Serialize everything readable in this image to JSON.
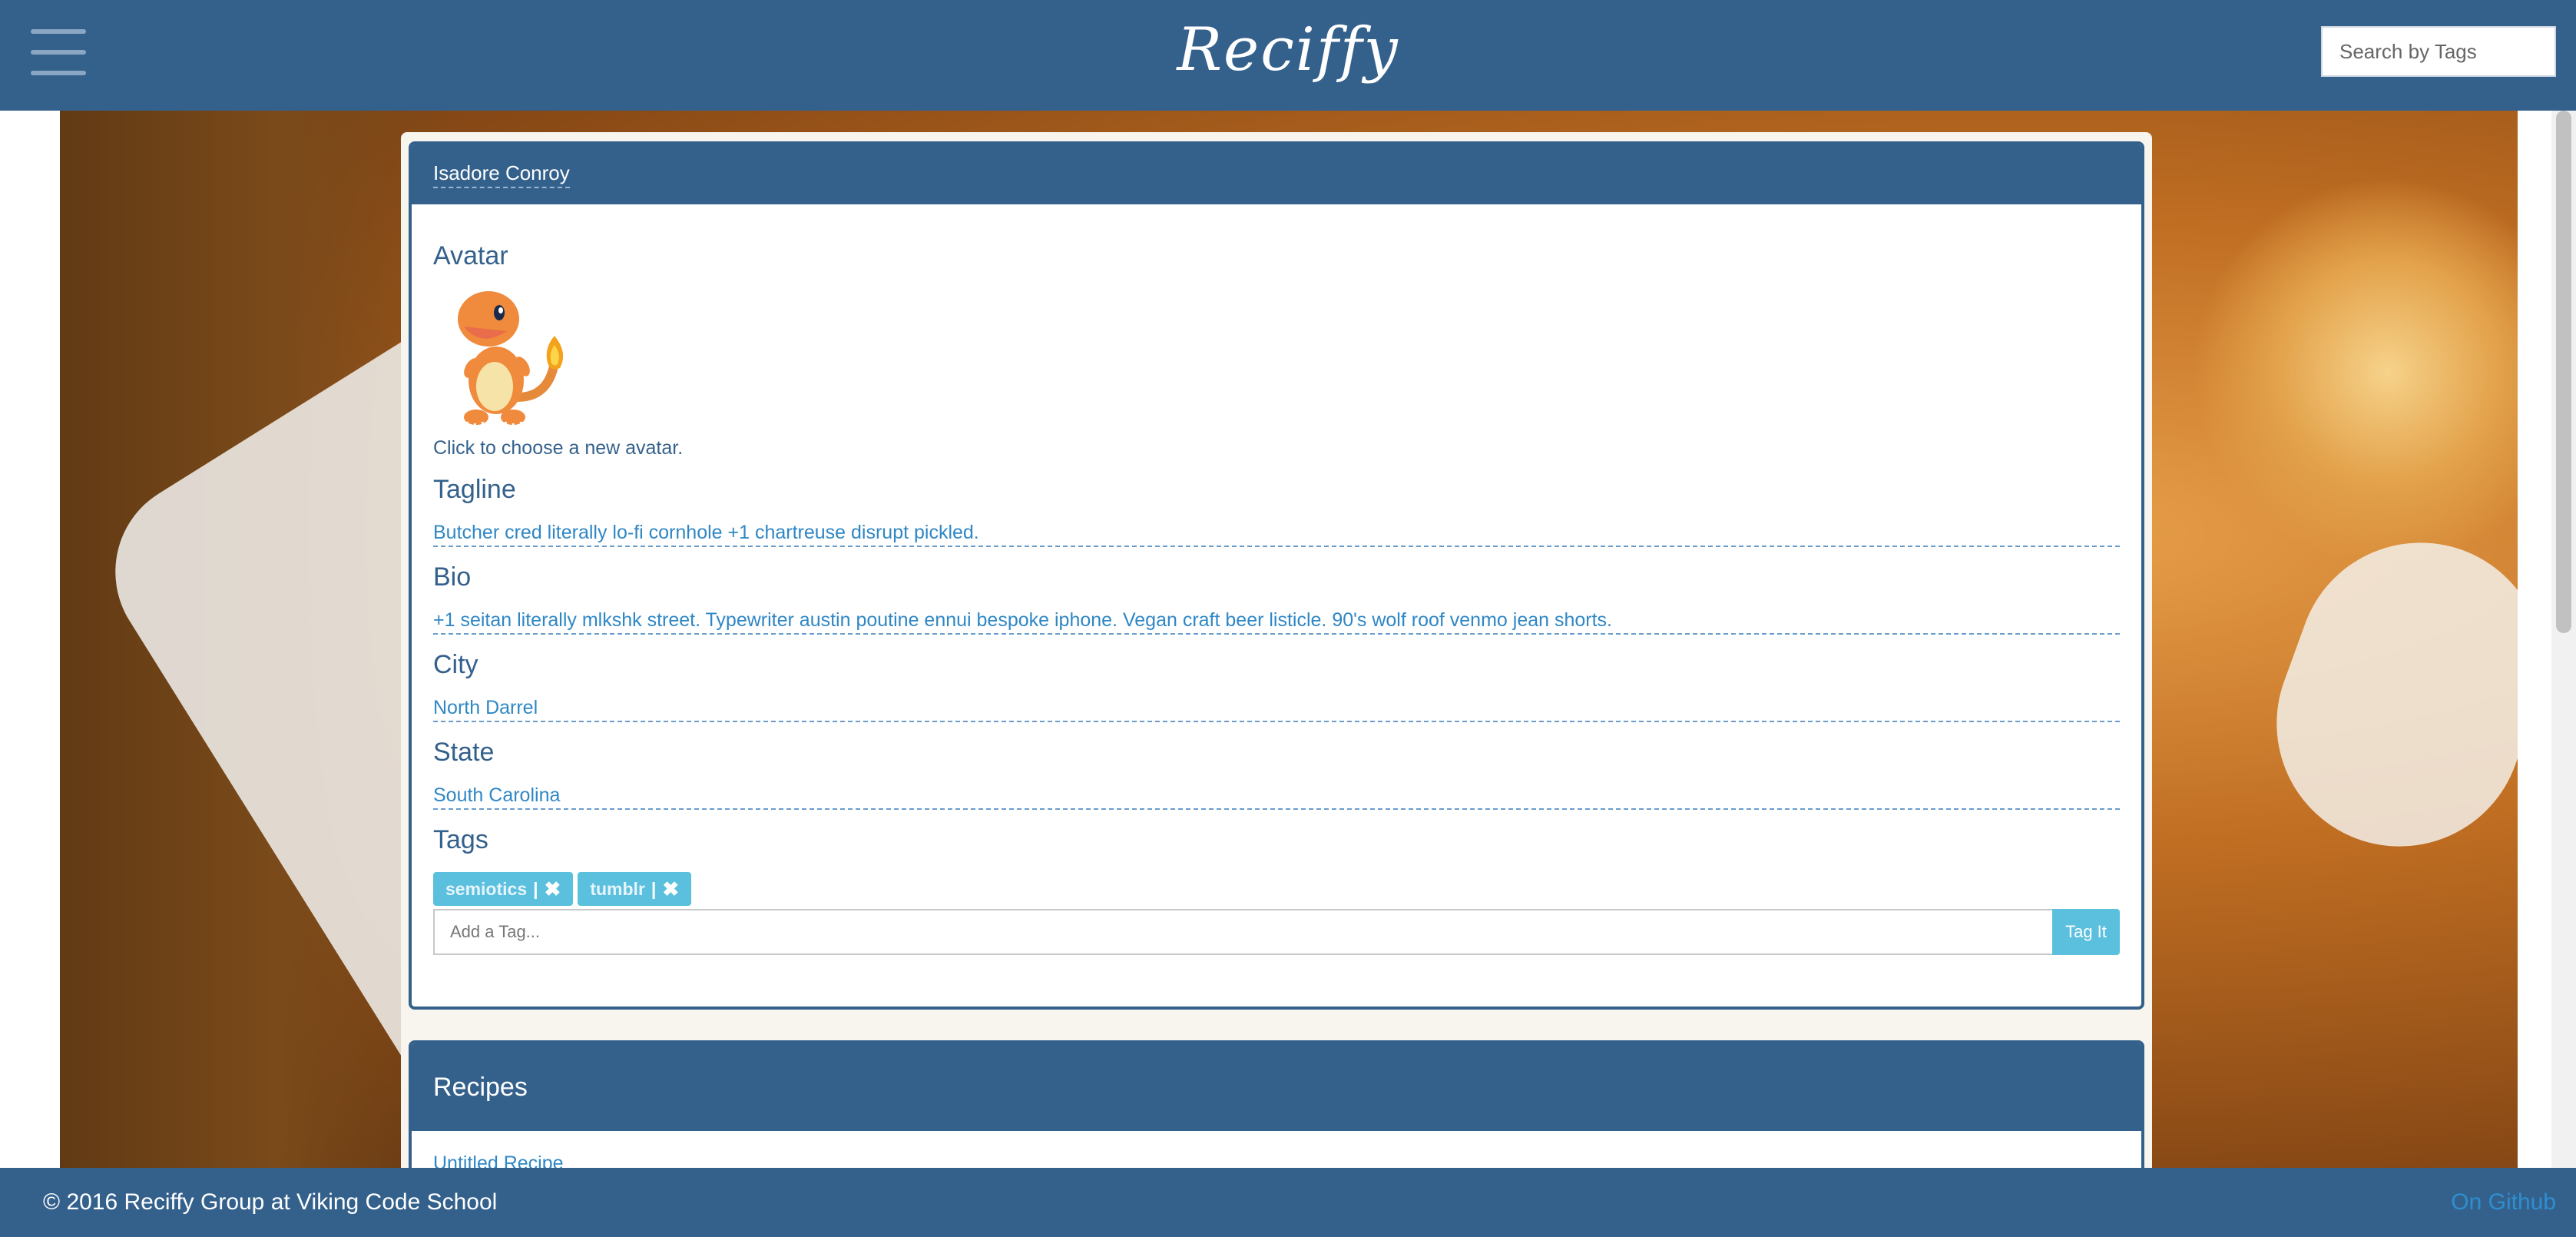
{
  "navbar": {
    "brand": "Reciffy",
    "search_placeholder": "Search by Tags"
  },
  "profile": {
    "name": "Isadore Conroy",
    "avatar_title": "Avatar",
    "avatar_note": "Click to choose a new avatar.",
    "fields": [
      {
        "label": "Tagline",
        "value": "Butcher cred literally lo-fi cornhole +1 chartreuse disrupt pickled."
      },
      {
        "label": "Bio",
        "value": "+1 seitan literally mlkshk street. Typewriter austin poutine ennui bespoke iphone. Vegan craft beer listicle. 90's wolf roof venmo jean shorts."
      },
      {
        "label": "City",
        "value": "North Darrel"
      },
      {
        "label": "State",
        "value": "South Carolina"
      }
    ],
    "tags_title": "Tags",
    "tags": [
      {
        "label": "semiotics",
        "separator": "|",
        "remove_icon": "close-icon"
      },
      {
        "label": "tumblr",
        "separator": "|",
        "remove_icon": "close-icon"
      }
    ],
    "add_tag_placeholder": "Add a Tag...",
    "tag_button": "Tag It"
  },
  "recipes": {
    "title": "Recipes",
    "items": [
      "Untitled Recipe"
    ]
  },
  "footer": {
    "copyright": "© 2016 Reciffy Group at Viking Code School",
    "github": "On Github"
  },
  "colors": {
    "primary": "#34618c",
    "link": "#2f87c5",
    "tag": "#5bc0de"
  }
}
